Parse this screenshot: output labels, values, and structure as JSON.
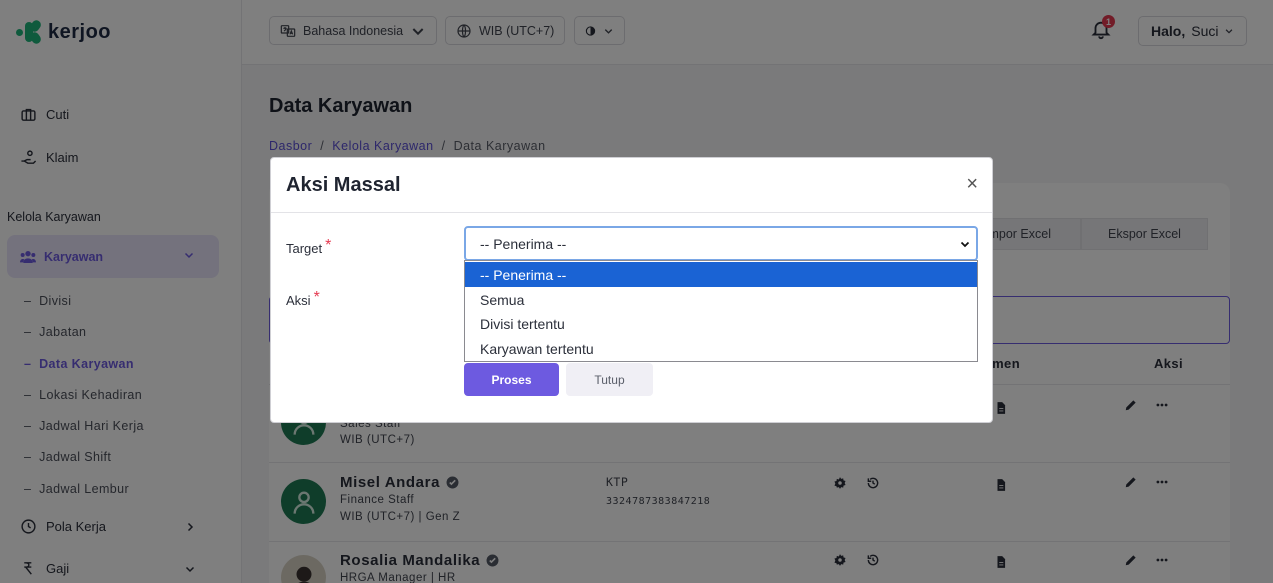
{
  "brand": {
    "name": "KerJoo"
  },
  "sidebar": {
    "items_top": [
      {
        "label": "Cuti",
        "icon": "briefcase-icon"
      },
      {
        "label": "Klaim",
        "icon": "hand-coin-icon"
      }
    ],
    "section_label": "Kelola Karyawan",
    "active_group": {
      "label": "Karyawan",
      "icon": "users-icon"
    },
    "sub_items": [
      {
        "label": "Divisi"
      },
      {
        "label": "Jabatan"
      },
      {
        "label": "Data Karyawan"
      },
      {
        "label": "Lokasi Kehadiran"
      },
      {
        "label": "Jadwal Hari Kerja"
      },
      {
        "label": "Jadwal Shift"
      },
      {
        "label": "Jadwal Lembur"
      }
    ],
    "items_bottom": [
      {
        "label": "Pola Kerja",
        "icon": "clock-icon"
      },
      {
        "label": "Gaji",
        "icon": "money-icon"
      }
    ]
  },
  "topbar": {
    "language": "Bahasa Indonesia",
    "timezone": "WIB (UTC+7)",
    "notification_count": "1",
    "greeting_bold": "Halo,",
    "greeting_name": "Suci"
  },
  "page": {
    "title": "Data Karyawan",
    "breadcrumb": [
      "Dasbor",
      "Kelola Karyawan",
      "Data Karyawan"
    ],
    "buttons": {
      "import": "Impor Excel",
      "export": "Ekspor Excel"
    },
    "table_headers": {
      "documents": "Dokumen",
      "actions": "Aksi"
    },
    "rows": [
      {
        "name": "",
        "role": "Sales Staff",
        "tz": "WIB (UTC+7)",
        "doc_type": "",
        "doc_no": ""
      },
      {
        "name": "Misel Andara",
        "role": "Finance Staff",
        "tz": "WIB (UTC+7) | Gen Z",
        "doc_type": "KTP",
        "doc_no": "3324787383847218"
      },
      {
        "name": "Rosalia Mandalika",
        "role": "HRGA Manager | HR",
        "tz": "",
        "doc_type": "",
        "doc_no": ""
      }
    ]
  },
  "modal": {
    "title": "Aksi Massal",
    "close_symbol": "×",
    "target_label": "Target",
    "action_label": "Aksi",
    "required_mark": "*",
    "select_value": "-- Penerima --",
    "options": [
      "-- Penerima --",
      "Semua",
      "Divisi tertentu",
      "Karyawan tertentu"
    ],
    "submit_label": "Proses",
    "close_label": "Tutup"
  },
  "colors": {
    "accent": "#6d5ae0",
    "brand": "#1fb57b",
    "select_highlight": "#1a63d4",
    "badge": "#e53950"
  }
}
